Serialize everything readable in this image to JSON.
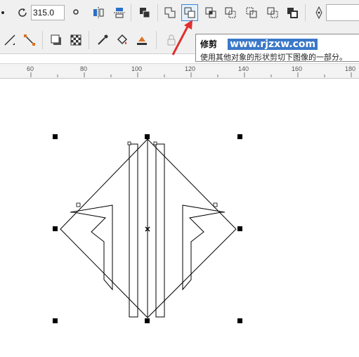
{
  "toolbar": {
    "rotation_value": "315.0",
    "icons_row1": [
      "rotate-icon",
      "mirror-horizontal-icon",
      "mirror-vertical-icon",
      "arrange-icon",
      "weld-icon",
      "trim-icon",
      "intersect-icon",
      "simplify-icon",
      "front-minus-back-icon",
      "back-minus-front-icon",
      "boundary-icon",
      "pen-nib-icon"
    ],
    "icons_row2": [
      "line-tool-icon",
      "connector-icon",
      "drop-shadow-icon",
      "transparency-icon",
      "eyedropper-icon",
      "fill-icon",
      "interactive-fill-icon",
      "lock-icon"
    ]
  },
  "tooltip": {
    "title": "修剪",
    "watermark": "www.rjzxw.com",
    "description": "使用其他对象的形状剪切下图像的一部分。"
  },
  "ruler": {
    "ticks": [
      "60",
      "80",
      "100",
      "120",
      "140",
      "160",
      "180"
    ]
  },
  "colors": {
    "toolbar_bg": "#f0f0f0",
    "active_button_border": "#3a86d6",
    "annotation_arrow": "#e03030"
  }
}
